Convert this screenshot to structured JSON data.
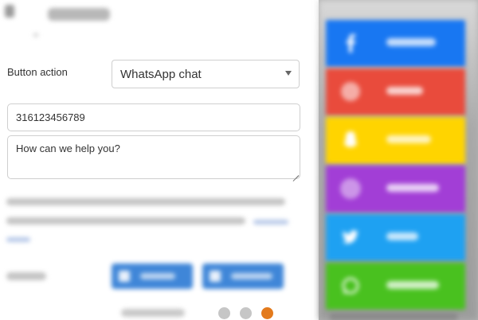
{
  "form": {
    "action_label": "Button action",
    "action_value": "WhatsApp chat",
    "phone_value": "316123456789",
    "message_value": "How can we help you?"
  },
  "pager": {
    "dots": [
      "inactive",
      "inactive",
      "active"
    ],
    "active_color": "#e37a1c",
    "inactive_color": "#c6c6c6"
  },
  "social_buttons": [
    {
      "network": "facebook",
      "icon": "facebook-icon",
      "color": "#1877f2"
    },
    {
      "network": "google",
      "icon": "google-icon",
      "color": "#e94b3c"
    },
    {
      "network": "snapchat",
      "icon": "snapchat-icon",
      "color": "#ffd400"
    },
    {
      "network": "instagram",
      "icon": "instagram-icon",
      "color": "#a23ed6"
    },
    {
      "network": "twitter",
      "icon": "twitter-icon",
      "color": "#1ea1f2"
    },
    {
      "network": "whatsapp",
      "icon": "whatsapp-icon",
      "color": "#49c11f"
    }
  ],
  "colors": {
    "toggle_button": "#3f86d8"
  }
}
